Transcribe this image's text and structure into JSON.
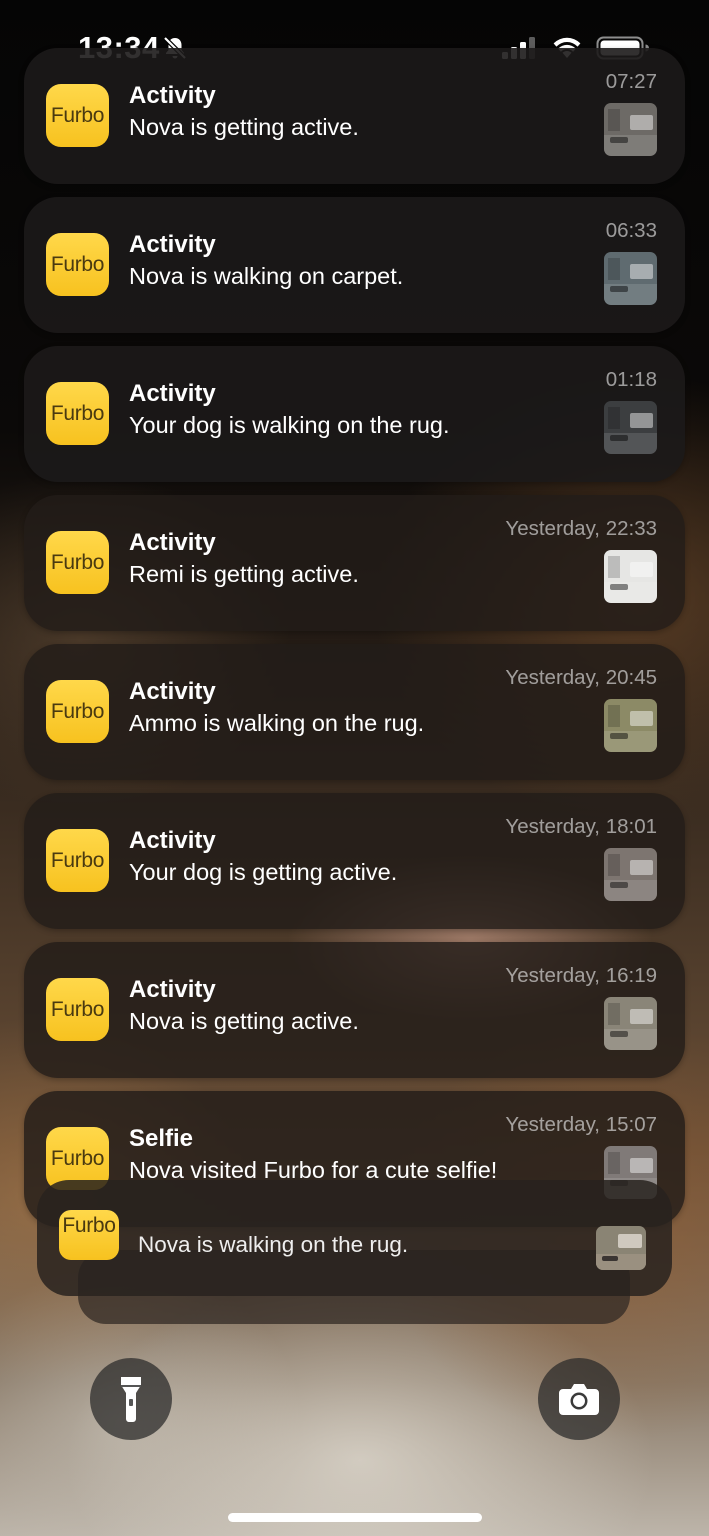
{
  "status_bar": {
    "time": "13:34",
    "icons": [
      "bell-slash-icon",
      "signal-icon",
      "wifi-icon",
      "battery-icon"
    ]
  },
  "notifications": [
    {
      "app_icon_text": "Furbo",
      "title": "Activity",
      "body": "Nova is getting active.",
      "time": "07:27",
      "thumb_tone": "#6d6a66"
    },
    {
      "app_icon_text": "Furbo",
      "title": "Activity",
      "body": "Nova is walking on carpet.",
      "time": "06:33",
      "thumb_tone": "#5f6b70"
    },
    {
      "app_icon_text": "Furbo",
      "title": "Activity",
      "body": "Your dog is walking on the rug.",
      "time": "01:18",
      "thumb_tone": "#3c3e40"
    },
    {
      "app_icon_text": "Furbo",
      "title": "Activity",
      "body": "Remi is getting active.",
      "time": "Yesterday, 22:33",
      "thumb_tone": "#e6e6e4"
    },
    {
      "app_icon_text": "Furbo",
      "title": "Activity",
      "body": "Ammo is walking on the rug.",
      "time": "Yesterday, 20:45",
      "thumb_tone": "#8c8a66"
    },
    {
      "app_icon_text": "Furbo",
      "title": "Activity",
      "body": "Your dog is getting active.",
      "time": "Yesterday, 18:01",
      "thumb_tone": "#7d7570"
    },
    {
      "app_icon_text": "Furbo",
      "title": "Activity",
      "body": "Nova is getting active.",
      "time": "Yesterday, 16:19",
      "thumb_tone": "#8a8578"
    },
    {
      "app_icon_text": "Furbo",
      "title": "Selfie",
      "body": "Nova visited Furbo for a cute selfie!",
      "time": "Yesterday, 15:07",
      "thumb_tone": "#807a78"
    }
  ],
  "stacked_notification": {
    "app_icon_text": "Furbo",
    "body": "Nova is walking on the rug.",
    "thumb_tone": "#8a8474"
  },
  "controls": {
    "flashlight_icon": "flashlight-icon",
    "camera_icon": "camera-icon"
  },
  "colors": {
    "furbo_yellow": "#f7c21f",
    "card_bg": "#1c1a1a",
    "secondary_text": "#a8a8a8"
  }
}
